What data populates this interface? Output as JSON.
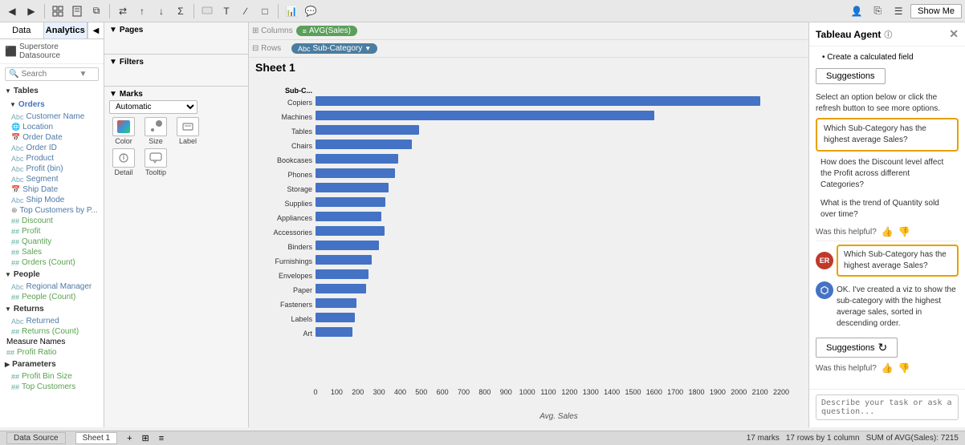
{
  "toolbar": {
    "show_me_label": "Show Me",
    "tabs": {
      "data": "Data",
      "analytics": "Analytics"
    }
  },
  "sidebar": {
    "datasource": "Superstore Datasource",
    "search_placeholder": "Search",
    "sections": {
      "tables": "Tables",
      "people": "People",
      "returns": "Returns",
      "parameters": "Parameters"
    },
    "orders_fields": [
      "Customer Name",
      "Location",
      "Order Date",
      "Order ID",
      "Product",
      "Profit (bin)",
      "Segment",
      "Ship Date",
      "Ship Mode",
      "Top Customers by P...",
      "Discount",
      "Profit",
      "Quantity",
      "Sales",
      "Orders (Count)"
    ],
    "people_fields": [
      "Regional Manager",
      "People (Count)"
    ],
    "returns_fields": [
      "Returned",
      "Returns (Count)"
    ],
    "measure_names": "Measure Names",
    "profit_ratio": "Profit Ratio",
    "param_fields": [
      "Profit Bin Size",
      "Top Customers"
    ]
  },
  "marks": {
    "type": "Automatic",
    "buttons": [
      "Color",
      "Size",
      "Label",
      "Detail",
      "Tooltip"
    ]
  },
  "columns_pill": "AVG(Sales)",
  "rows_pill": "Sub-Category",
  "sheet_title": "Sheet 1",
  "col_header": "Sub-C...",
  "chart": {
    "x_axis_title": "Avg. Sales",
    "x_labels": [
      "0",
      "100",
      "200",
      "300",
      "400",
      "500",
      "600",
      "700",
      "800",
      "900",
      "1000",
      "1100",
      "1200",
      "1300",
      "1400",
      "1500",
      "1600",
      "1700",
      "1800",
      "1900",
      "2000",
      "2100",
      "2200"
    ],
    "bars": [
      {
        "label": "Copiers",
        "value": 2100,
        "max": 2200
      },
      {
        "label": "Machines",
        "value": 1600,
        "max": 2200
      },
      {
        "label": "Tables",
        "value": 490,
        "max": 2200
      },
      {
        "label": "Chairs",
        "value": 455,
        "max": 2200
      },
      {
        "label": "Bookcases",
        "value": 390,
        "max": 2200
      },
      {
        "label": "Phones",
        "value": 375,
        "max": 2200
      },
      {
        "label": "Storage",
        "value": 345,
        "max": 2200
      },
      {
        "label": "Supplies",
        "value": 330,
        "max": 2200
      },
      {
        "label": "Appliances",
        "value": 310,
        "max": 2200
      },
      {
        "label": "Accessories",
        "value": 325,
        "max": 2200
      },
      {
        "label": "Binders",
        "value": 300,
        "max": 2200
      },
      {
        "label": "Furnishings",
        "value": 265,
        "max": 2200
      },
      {
        "label": "Envelopes",
        "value": 250,
        "max": 2200
      },
      {
        "label": "Paper",
        "value": 240,
        "max": 2200
      },
      {
        "label": "Fasteners",
        "value": 195,
        "max": 2200
      },
      {
        "label": "Labels",
        "value": 185,
        "max": 2200
      },
      {
        "label": "Art",
        "value": 175,
        "max": 2200
      }
    ]
  },
  "agent": {
    "title": "Tableau Agent",
    "close_label": "✕",
    "bullet": "Create a calculated field",
    "suggestions_label": "Suggestions",
    "intro_text": "Select an option below or click the refresh button to see more options.",
    "suggestions": [
      {
        "id": "s1",
        "text": "Which Sub-Category has the highest average Sales?",
        "highlighted": true
      },
      {
        "id": "s2",
        "text": "How does the Discount level affect the Profit across different Categories?"
      },
      {
        "id": "s3",
        "text": "What is the trend of Quantity sold over time?"
      }
    ],
    "helpful_label": "Was this helpful?",
    "user_message": "Which Sub-Category has the highest average Sales?",
    "bot_response": "OK. I've created a viz to show the sub-category with the highest average sales, sorted in descending order.",
    "suggestions2_label": "Suggestions",
    "helpful2_label": "Was this helpful?",
    "input_placeholder": "Describe your task or ask a question..."
  },
  "status_bar": {
    "marks": "17 marks",
    "rows": "17 rows by 1 column",
    "sum": "SUM of AVG(Sales): 7215"
  },
  "bottom_tabs": {
    "data_source": "Data Source",
    "sheet1": "Sheet 1"
  }
}
